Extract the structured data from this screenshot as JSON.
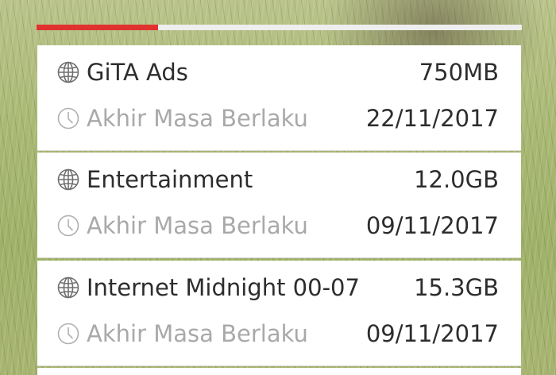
{
  "quota_progress": 0.25,
  "colors": {
    "accent": "#e0322f",
    "card_background": "#ffffff",
    "primary_text": "#2d2d2d",
    "secondary_text": "#a9a9a9"
  },
  "icons": {
    "name": "globe-icon",
    "expiry": "clock-icon"
  },
  "packages": [
    {
      "name": "GiTA Ads",
      "value": "750MB",
      "expiry_label": "Akhir Masa Berlaku",
      "expiry_date": "22/11/2017"
    },
    {
      "name": "Entertainment",
      "value": "12.0GB",
      "expiry_label": "Akhir Masa Berlaku",
      "expiry_date": "09/11/2017"
    },
    {
      "name": "Internet Midnight 00-07",
      "value": "15.3GB",
      "expiry_label": "Akhir Masa Berlaku",
      "expiry_date": "09/11/2017"
    }
  ]
}
